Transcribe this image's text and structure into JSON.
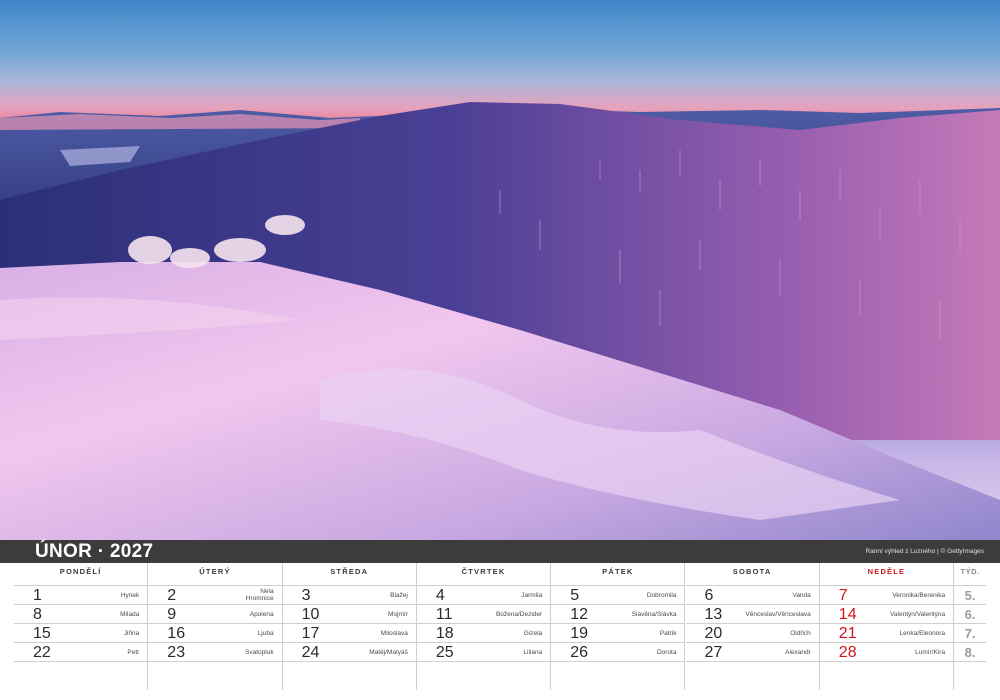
{
  "header": {
    "month_title": "ÚNOR · 2027",
    "photo_credit": "Ranní výhled z Luzného | © GettyImages"
  },
  "colors": {
    "header_bar": "#3c3c3c",
    "sunday_red": "#d0161b",
    "grid_line": "#cfcfcf"
  },
  "calendar": {
    "days": [
      {
        "label": "PONDĚLÍ",
        "cells": [
          {
            "num": "1",
            "name": "Hynek"
          },
          {
            "num": "8",
            "name": "Milada"
          },
          {
            "num": "15",
            "name": "Jiřina"
          },
          {
            "num": "22",
            "name": "Petr"
          }
        ]
      },
      {
        "label": "ÚTERÝ",
        "cells": [
          {
            "num": "2",
            "name": "Nela",
            "name2": "Hromnice"
          },
          {
            "num": "9",
            "name": "Apolena"
          },
          {
            "num": "16",
            "name": "Ljuba"
          },
          {
            "num": "23",
            "name": "Svatopluk"
          }
        ]
      },
      {
        "label": "STŘEDA",
        "cells": [
          {
            "num": "3",
            "name": "Blažej"
          },
          {
            "num": "10",
            "name": "Mojmír"
          },
          {
            "num": "17",
            "name": "Miloslava"
          },
          {
            "num": "24",
            "name": "Matěj/Matyáš"
          }
        ]
      },
      {
        "label": "ČTVRTEK",
        "cells": [
          {
            "num": "4",
            "name": "Jarmila"
          },
          {
            "num": "11",
            "name": "Božena/Dezider"
          },
          {
            "num": "18",
            "name": "Gizela"
          },
          {
            "num": "25",
            "name": "Liliana"
          }
        ]
      },
      {
        "label": "PÁTEK",
        "cells": [
          {
            "num": "5",
            "name": "Dobromila"
          },
          {
            "num": "12",
            "name": "Slavěna/Slávka"
          },
          {
            "num": "19",
            "name": "Patrik"
          },
          {
            "num": "26",
            "name": "Dorota"
          }
        ]
      },
      {
        "label": "SOBOTA",
        "cells": [
          {
            "num": "6",
            "name": "Vanda"
          },
          {
            "num": "13",
            "name": "Věnceslav/Věnceslava"
          },
          {
            "num": "20",
            "name": "Oldřich"
          },
          {
            "num": "27",
            "name": "Alexandr"
          }
        ]
      },
      {
        "label": "NEDĚLE",
        "cells": [
          {
            "num": "7",
            "name": "Veronika/Berenika"
          },
          {
            "num": "14",
            "name": "Valentýn/Valentýna"
          },
          {
            "num": "21",
            "name": "Lenka/Eleonora"
          },
          {
            "num": "28",
            "name": "Lumír/Kira"
          }
        ]
      }
    ],
    "week_label": "TÝD.",
    "weeks": [
      "5.",
      "6.",
      "7.",
      "8."
    ]
  }
}
